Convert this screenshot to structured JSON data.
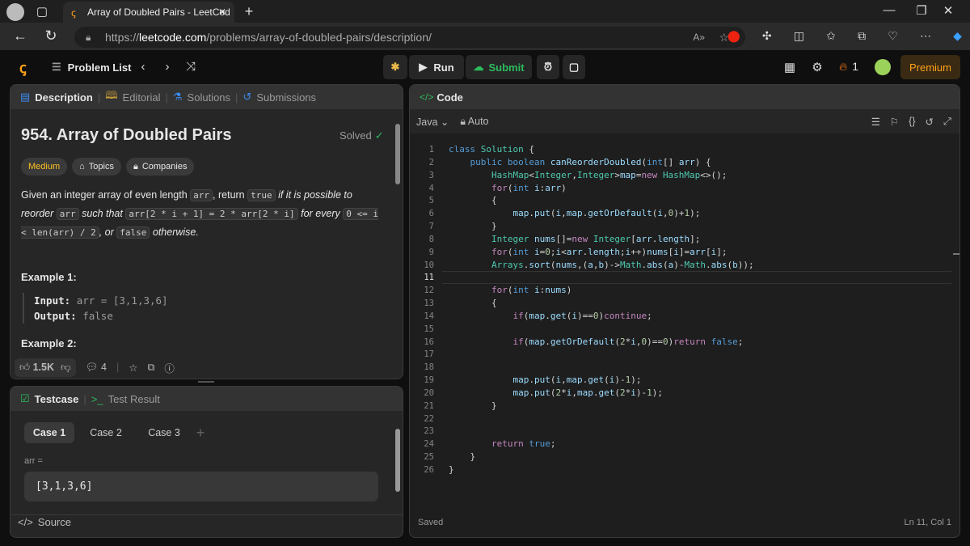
{
  "browser": {
    "tab_title": "Array of Doubled Pairs - LeetCod",
    "url_prefix": "https://",
    "url_domain": "leetcode.com",
    "url_path": "/problems/array-of-doubled-pairs/description/"
  },
  "topbar": {
    "problem_list": "Problem List",
    "run": "Run",
    "submit": "Submit",
    "streak": "1",
    "premium": "Premium"
  },
  "left_tabs": [
    "Description",
    "Editorial",
    "Solutions",
    "Submissions"
  ],
  "problem": {
    "title": "954. Array of Doubled Pairs",
    "status": "Solved",
    "difficulty": "Medium",
    "topics": "Topics",
    "companies": "Companies",
    "desc": {
      "t1": "Given an integer array of even length ",
      "c1": "arr",
      "t2": ", return ",
      "c2": "true",
      "t3": " if it is possible to reorder ",
      "c3": "arr",
      "t4": " such that ",
      "c4": "arr[2 * i + 1] = 2 * arr[2 * i]",
      "t5": " for every ",
      "c5": "0 <= i < len(arr) / 2",
      "t6": ", or ",
      "c6": "false",
      "t7": " otherwise."
    },
    "example1_title": "Example 1:",
    "example1_input_label": "Input:",
    "example1_input": "arr = [3,1,3,6]",
    "example1_output_label": "Output:",
    "example1_output": "false",
    "example2_title": "Example 2:",
    "likes": "1.5K",
    "comments": "4"
  },
  "testcase": {
    "tab": "Testcase",
    "result_tab": "Test Result",
    "cases": [
      "Case 1",
      "Case 2",
      "Case 3"
    ],
    "param_label": "arr =",
    "param_value": "[3,1,3,6]",
    "source": "Source"
  },
  "editor": {
    "title": "Code",
    "language": "Java",
    "mode": "Auto",
    "status": "Saved",
    "cursor": "Ln 11, Col 1",
    "active_line": 11,
    "lines": [
      "class Solution {",
      "    public boolean canReorderDoubled(int[] arr) {",
      "        HashMap<Integer,Integer>map=new HashMap<>();",
      "        for(int i:arr)",
      "        {",
      "            map.put(i,map.getOrDefault(i,0)+1);",
      "        }",
      "        Integer nums[]=new Integer[arr.length];",
      "        for(int i=0;i<arr.length;i++)nums[i]=arr[i];",
      "        Arrays.sort(nums,(a,b)->Math.abs(a)-Math.abs(b));",
      "",
      "        for(int i:nums)",
      "        {",
      "            if(map.get(i)==0)continue;",
      "",
      "            if(map.getOrDefault(2*i,0)==0)return false;",
      "",
      "",
      "            map.put(i,map.get(i)-1);",
      "            map.put(2*i,map.get(2*i)-1);",
      "        }",
      "",
      "",
      "        return true;",
      "    }",
      "}"
    ]
  },
  "colors": {
    "accent_green": "#2cbb5d",
    "medium": "#ffc01e",
    "premium": "#ffa116"
  }
}
